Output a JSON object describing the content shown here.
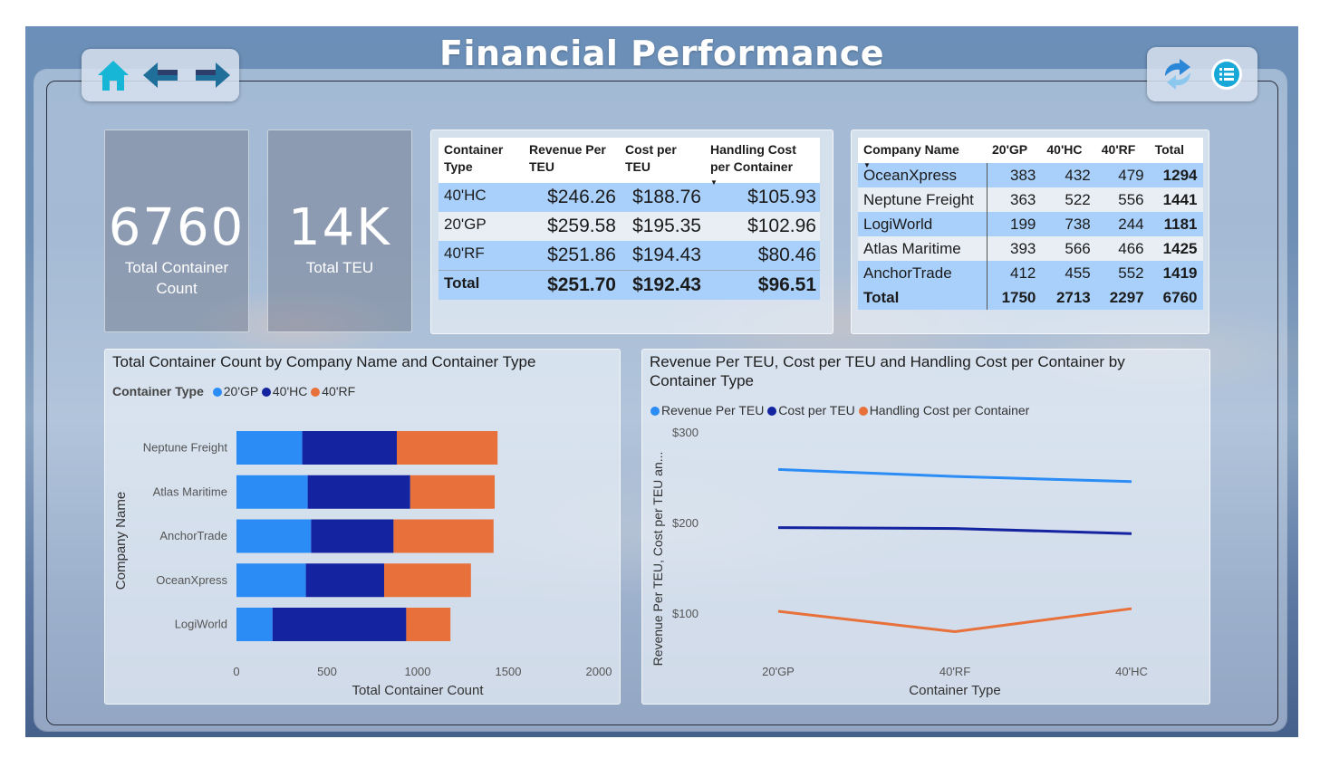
{
  "title": "Financial Performance",
  "colors": {
    "c20gp": "#2b8cf5",
    "c40hc": "#1424a0",
    "c40rf": "#e8703a"
  },
  "kpis": [
    {
      "value": "6760",
      "label": "Total Container Count"
    },
    {
      "value": "14K",
      "label": "Total TEU"
    }
  ],
  "cost_table": {
    "headers": [
      "Container Type",
      "Revenue Per TEU",
      "Cost per TEU",
      "Handling Cost per Container"
    ],
    "rows": [
      [
        "40'HC",
        "$246.26",
        "$188.76",
        "$105.93"
      ],
      [
        "20'GP",
        "$259.58",
        "$195.35",
        "$102.96"
      ],
      [
        "40'RF",
        "$251.86",
        "$194.43",
        "$80.46"
      ]
    ],
    "total": [
      "Total",
      "$251.70",
      "$192.43",
      "$96.51"
    ]
  },
  "company_table": {
    "headers": [
      "Company Name",
      "20'GP",
      "40'HC",
      "40'RF",
      "Total"
    ],
    "rows": [
      [
        "OceanXpress",
        "383",
        "432",
        "479",
        "1294"
      ],
      [
        "Neptune Freight",
        "363",
        "522",
        "556",
        "1441"
      ],
      [
        "LogiWorld",
        "199",
        "738",
        "244",
        "1181"
      ],
      [
        "Atlas Maritime",
        "393",
        "566",
        "466",
        "1425"
      ],
      [
        "AnchorTrade",
        "412",
        "455",
        "552",
        "1419"
      ]
    ],
    "total": [
      "Total",
      "1750",
      "2713",
      "2297",
      "6760"
    ]
  },
  "bar_chart": {
    "title": "Total Container Count by Company Name and Container Type",
    "legend_title": "Container Type",
    "legend": [
      "20'GP",
      "40'HC",
      "40'RF"
    ]
  },
  "line_chart": {
    "title": "Revenue Per TEU, Cost per TEU and Handling Cost per Container by Container Type",
    "legend": [
      "Revenue Per TEU",
      "Cost per TEU",
      "Handling Cost per Container"
    ]
  },
  "chart_data": [
    {
      "type": "bar",
      "orientation": "horizontal",
      "stacked": true,
      "title": "Total Container Count by Company Name and Container Type",
      "xlabel": "Total Container Count",
      "ylabel": "Company Name",
      "categories": [
        "Neptune Freight",
        "Atlas Maritime",
        "AnchorTrade",
        "OceanXpress",
        "LogiWorld"
      ],
      "series": [
        {
          "name": "20'GP",
          "values": [
            363,
            393,
            412,
            383,
            199
          ]
        },
        {
          "name": "40'HC",
          "values": [
            522,
            566,
            455,
            432,
            738
          ]
        },
        {
          "name": "40'RF",
          "values": [
            556,
            466,
            552,
            479,
            244
          ]
        }
      ],
      "xlim": [
        0,
        2000
      ],
      "xticks": [
        "0",
        "500",
        "1000",
        "1500",
        "2000"
      ],
      "legend_position": "top-left"
    },
    {
      "type": "line",
      "title": "Revenue Per TEU, Cost per TEU and Handling Cost per Container by Container Type",
      "xlabel": "Container Type",
      "ylabel": "Revenue Per TEU, Cost per TEU an...",
      "x": [
        "20'GP",
        "40'RF",
        "40'HC"
      ],
      "series": [
        {
          "name": "Revenue Per TEU",
          "values": [
            259.58,
            251.86,
            246.26
          ]
        },
        {
          "name": "Cost per TEU",
          "values": [
            195.35,
            194.43,
            188.76
          ]
        },
        {
          "name": "Handling Cost per Container",
          "values": [
            102.96,
            80.46,
            105.93
          ]
        }
      ],
      "ylim": [
        50,
        300
      ],
      "yticks": [
        "$100",
        "$200",
        "$300"
      ],
      "legend_position": "top-left"
    }
  ]
}
